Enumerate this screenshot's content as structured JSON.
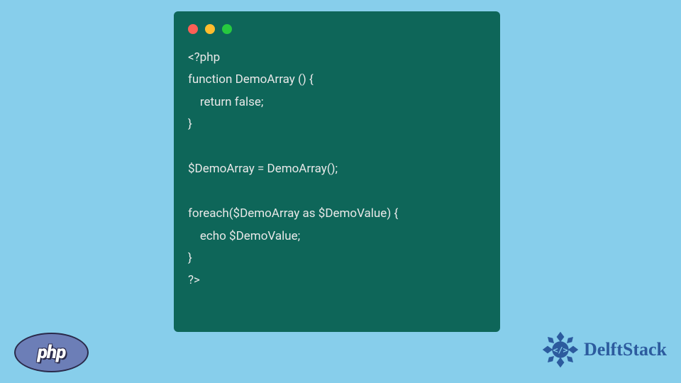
{
  "code": {
    "lines": [
      "<?php",
      "function DemoArray () {",
      "    return false;",
      "}",
      "",
      "$DemoArray = DemoArray();",
      "",
      "foreach($DemoArray as $DemoValue) {",
      "    echo $DemoValue;",
      "}",
      "?>"
    ]
  },
  "badges": {
    "php_label": "php",
    "delftstack_label": "DelftStack"
  }
}
